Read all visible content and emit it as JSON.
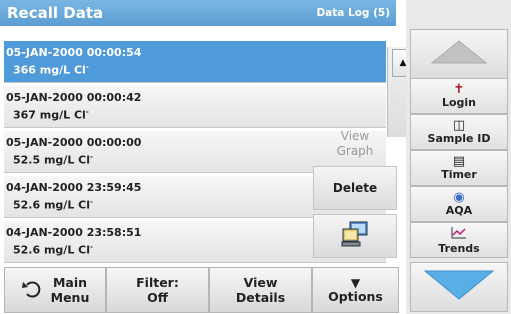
{
  "header": {
    "title": "Recall Data",
    "log_label": "Data Log (5)"
  },
  "records": [
    {
      "datetime": "05-JAN-2000  00:00:54",
      "value": "366  mg/L  Cl",
      "unit_sup": "-",
      "selected": true
    },
    {
      "datetime": "05-JAN-2000  00:00:42",
      "value": "367  mg/L  Cl",
      "unit_sup": "-",
      "selected": false
    },
    {
      "datetime": "05-JAN-2000  00:00:00",
      "value": "52.5  mg/L  Cl",
      "unit_sup": "-",
      "selected": false
    },
    {
      "datetime": "04-JAN-2000  23:59:45",
      "value": "52.6  mg/L  Cl",
      "unit_sup": "-",
      "selected": false
    },
    {
      "datetime": "04-JAN-2000  23:58:51",
      "value": "52.6  mg/L  Cl",
      "unit_sup": "-",
      "selected": false
    }
  ],
  "actions": {
    "view_graph": [
      "View",
      "Graph"
    ],
    "delete": "Delete",
    "export_icon": "computer-icon"
  },
  "bottom": {
    "main_menu": [
      "Main",
      "Menu"
    ],
    "filter": [
      "Filter:",
      "Off"
    ],
    "view_details": [
      "View",
      "Details"
    ],
    "options": "Options"
  },
  "sidebar": {
    "login": "Login",
    "sample_id": "Sample ID",
    "timer": "Timer",
    "aqa": "AQA",
    "trends": "Trends"
  },
  "colors": {
    "title_bar": "#5d9dd2",
    "selected_row": "#4f9bd9",
    "sidebar_arrow": "#5aaee6"
  }
}
